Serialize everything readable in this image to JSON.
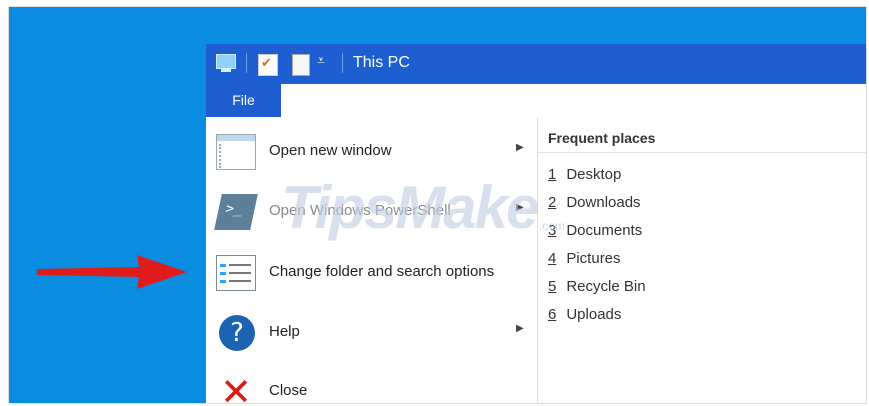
{
  "window": {
    "title": "This PC"
  },
  "ribbon": {
    "file_tab": "File"
  },
  "file_menu": {
    "items": [
      {
        "label": "Open new window",
        "icon": "new-window-icon",
        "has_submenu": true,
        "enabled": true
      },
      {
        "label": "Open Windows PowerShell",
        "icon": "powershell-icon",
        "has_submenu": true,
        "enabled": false
      },
      {
        "label": "Change folder and search options",
        "icon": "folder-options-icon",
        "has_submenu": false,
        "enabled": true
      },
      {
        "label": "Help",
        "icon": "help-icon",
        "has_submenu": true,
        "enabled": true
      },
      {
        "label": "Close",
        "icon": "close-icon",
        "has_submenu": false,
        "enabled": true
      }
    ]
  },
  "frequent_places": {
    "header": "Frequent places",
    "items": [
      {
        "num": "1",
        "label": "Desktop"
      },
      {
        "num": "2",
        "label": "Downloads"
      },
      {
        "num": "3",
        "label": "Documents"
      },
      {
        "num": "4",
        "label": "Pictures"
      },
      {
        "num": "5",
        "label": "Recycle Bin"
      },
      {
        "num": "6",
        "label": "Uploads"
      }
    ]
  },
  "watermark": {
    "text": "TipsMake",
    "sub": ".com"
  },
  "colors": {
    "desktop": "#0a8ce0",
    "titlebar": "#1d5fd1",
    "arrow": "#e01b1b",
    "close_icon": "#dd1c1a",
    "help_icon": "#1d63b3"
  }
}
